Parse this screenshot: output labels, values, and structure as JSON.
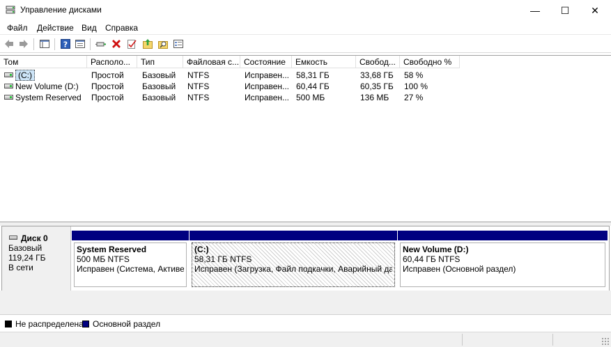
{
  "window": {
    "title": "Управление дисками",
    "minimize": "—",
    "maximize": "☐",
    "close": "✕"
  },
  "menu": [
    "Файл",
    "Действие",
    "Вид",
    "Справка"
  ],
  "toolbar_icons": [
    "back-arrow-icon",
    "forward-arrow-icon",
    "console-tree-icon",
    "help-icon",
    "properties-icon",
    "connect-icon",
    "delete-icon",
    "checkmark-icon",
    "folder-up-icon",
    "search-folder-icon",
    "view-list-icon"
  ],
  "volume_list": {
    "columns": [
      "Том",
      "Располо...",
      "Тип",
      "Файловая с...",
      "Состояние",
      "Емкость",
      "Свобод...",
      "Свободно %"
    ],
    "rows": [
      {
        "name": "(C:)",
        "layout": "Простой",
        "type": "Базовый",
        "fs": "NTFS",
        "status": "Исправен...",
        "capacity": "58,31 ГБ",
        "free": "33,68 ГБ",
        "free_pct": "58 %",
        "selected": true
      },
      {
        "name": "New Volume (D:)",
        "layout": "Простой",
        "type": "Базовый",
        "fs": "NTFS",
        "status": "Исправен...",
        "capacity": "60,44 ГБ",
        "free": "60,35 ГБ",
        "free_pct": "100 %",
        "selected": false
      },
      {
        "name": "System Reserved",
        "layout": "Простой",
        "type": "Базовый",
        "fs": "NTFS",
        "status": "Исправен...",
        "capacity": "500 МБ",
        "free": "136 МБ",
        "free_pct": "27 %",
        "selected": false
      }
    ]
  },
  "disk": {
    "title": "Диск 0",
    "type": "Базовый",
    "size": "119,24 ГБ",
    "status": "В сети"
  },
  "partitions": [
    {
      "name": "System Reserved",
      "size": "500 МБ NTFS",
      "status": "Исправен (Система, Активен,"
    },
    {
      "name": "(C:)",
      "size": "58,31 ГБ NTFS",
      "status": "Исправен (Загрузка, Файл подкачки, Аварийный дамп"
    },
    {
      "name": "New Volume  (D:)",
      "size": "60,44 ГБ NTFS",
      "status": "Исправен (Основной раздел)"
    }
  ],
  "legend": {
    "unallocated": "Не распределена",
    "primary": "Основной раздел",
    "unallocated_color": "#000000",
    "primary_color": "#000080"
  }
}
